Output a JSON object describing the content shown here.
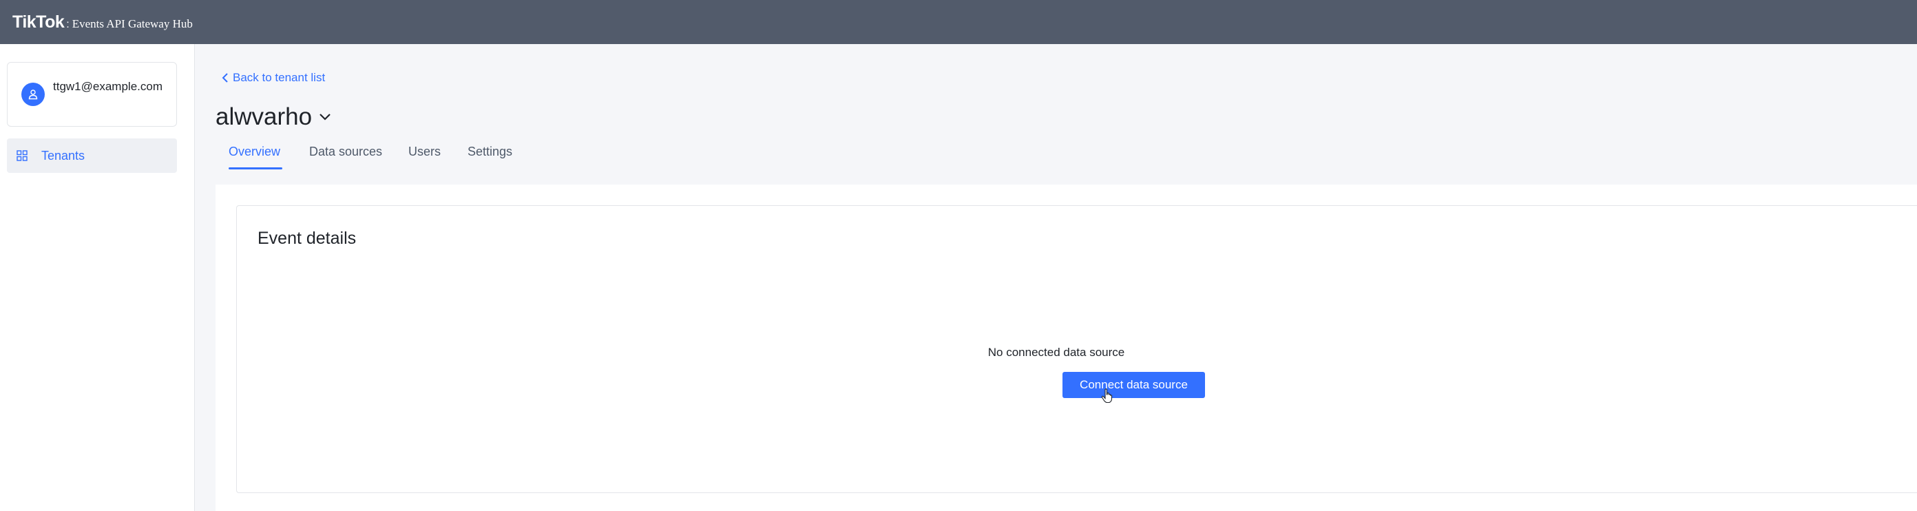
{
  "header": {
    "brand": "TikTok",
    "separator": ":",
    "product": "Events API Gateway Hub"
  },
  "sidebar": {
    "user_email": "ttgw1@example.com",
    "nav_items": [
      {
        "label": "Tenants",
        "icon": "grid-icon",
        "active": true
      }
    ]
  },
  "main": {
    "back_link": "Back to tenant list",
    "tenant_name": "alwvarho",
    "tabs": [
      {
        "label": "Overview",
        "active": true
      },
      {
        "label": "Data sources",
        "active": false
      },
      {
        "label": "Users",
        "active": false
      },
      {
        "label": "Settings",
        "active": false
      }
    ],
    "event_card": {
      "title": "Event details",
      "empty_message": "No connected data source",
      "connect_button": "Connect data source"
    }
  },
  "colors": {
    "header_bg": "#525b6b",
    "accent": "#3370ff",
    "page_bg": "#f5f6f9"
  }
}
